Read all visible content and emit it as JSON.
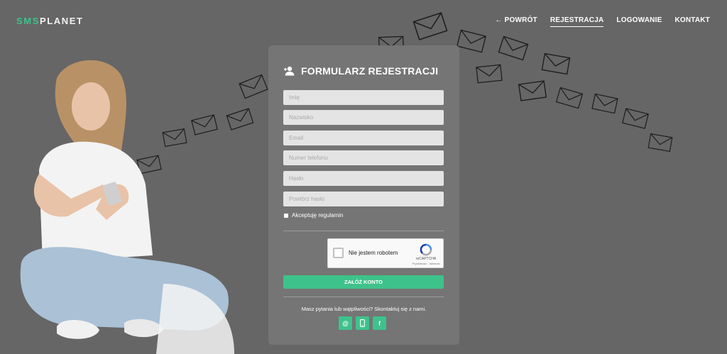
{
  "header": {
    "logo_accent": "SMS",
    "logo_rest": "PLANET",
    "nav": {
      "back": "← POWRÓT",
      "register": "REJESTRACJA",
      "login": "LOGOWANIE",
      "contact": "KONTAKT"
    },
    "active_nav": "register"
  },
  "form": {
    "title": "FORMULARZ REJESTRACJI",
    "fields": {
      "first_name": {
        "placeholder": "Imię",
        "value": ""
      },
      "last_name": {
        "placeholder": "Nazwisko",
        "value": ""
      },
      "email": {
        "placeholder": "Email",
        "value": ""
      },
      "phone": {
        "placeholder": "Numer telefonu",
        "value": ""
      },
      "password": {
        "placeholder": "Hasło",
        "value": ""
      },
      "password_repeat": {
        "placeholder": "Powtórz hasło",
        "value": ""
      }
    },
    "terms_label": "Akceptuję regulamin",
    "terms_checked": false,
    "captcha": {
      "label": "Nie jestem robotem",
      "brand": "reCAPTCHA",
      "links": "Prywatność - Warunki",
      "checked": false
    },
    "submit_label": "ZAŁÓŻ KONTO",
    "help_text": "Masz pytania lub wątpliwości? Skontaktuj się z nami.",
    "socials": [
      {
        "icon": "at-icon",
        "glyph": "@"
      },
      {
        "icon": "phone-icon",
        "glyph": "▯"
      },
      {
        "icon": "facebook-icon",
        "glyph": "f"
      }
    ]
  },
  "colors": {
    "background": "#666666",
    "card": "#757575",
    "accent": "#3ec28b"
  }
}
